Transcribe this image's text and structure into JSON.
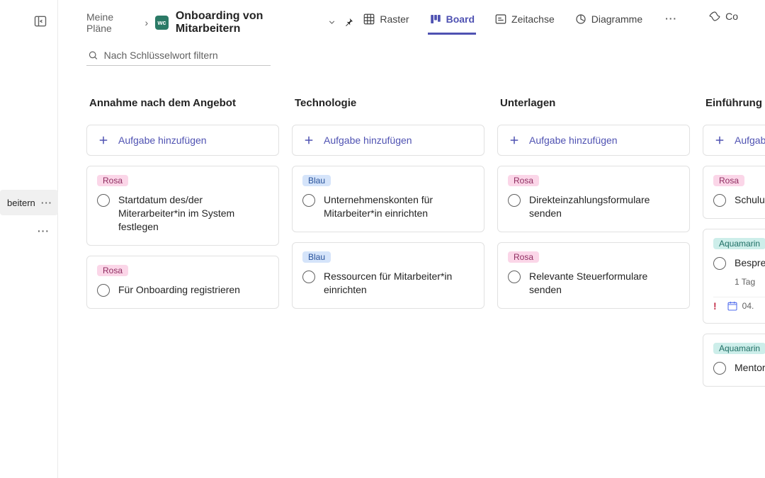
{
  "rail": {
    "selected_label": "beitern"
  },
  "breadcrumb": {
    "root": "Meine Pläne",
    "avatar_initials": "wc",
    "title": "Onboarding von Mitarbeitern"
  },
  "views": {
    "grid": "Raster",
    "board": "Board",
    "timeline": "Zeitachse",
    "charts": "Diagramme",
    "copilot": "Co"
  },
  "search": {
    "placeholder": "Nach Schlüsselwort filtern"
  },
  "add_task_label": "Aufgabe hinzufügen",
  "tags": {
    "rosa": "Rosa",
    "blau": "Blau",
    "aqua": "Aquamarin"
  },
  "columns": [
    {
      "title": "Annahme nach dem Angebot",
      "cards": [
        {
          "tag": "rosa",
          "title": "Startdatum des/der Miterarbeiter*in im System festlegen"
        },
        {
          "tag": "rosa",
          "title": "Für Onboarding registrieren"
        }
      ]
    },
    {
      "title": "Technologie",
      "cards": [
        {
          "tag": "blau",
          "title": "Unternehmenskonten für Mitarbeiter*in einrichten"
        },
        {
          "tag": "blau",
          "title": "Ressourcen für Mitarbeiter*in einrichten"
        }
      ]
    },
    {
      "title": "Unterlagen",
      "cards": [
        {
          "tag": "rosa",
          "title": "Direkteinzahlungsformulare senden"
        },
        {
          "tag": "rosa",
          "title": "Relevante Steuerformulare senden"
        }
      ]
    },
    {
      "title": "Einführung",
      "cards": [
        {
          "tag": "rosa",
          "title": "Schulung Einführung"
        },
        {
          "tag": "aqua",
          "title": "Besprechung Teammitglied",
          "meta": {
            "duration": "1 Tag",
            "alert": true,
            "due": "04."
          }
        },
        {
          "tag": "aqua",
          "title": "Mentor"
        }
      ]
    }
  ]
}
